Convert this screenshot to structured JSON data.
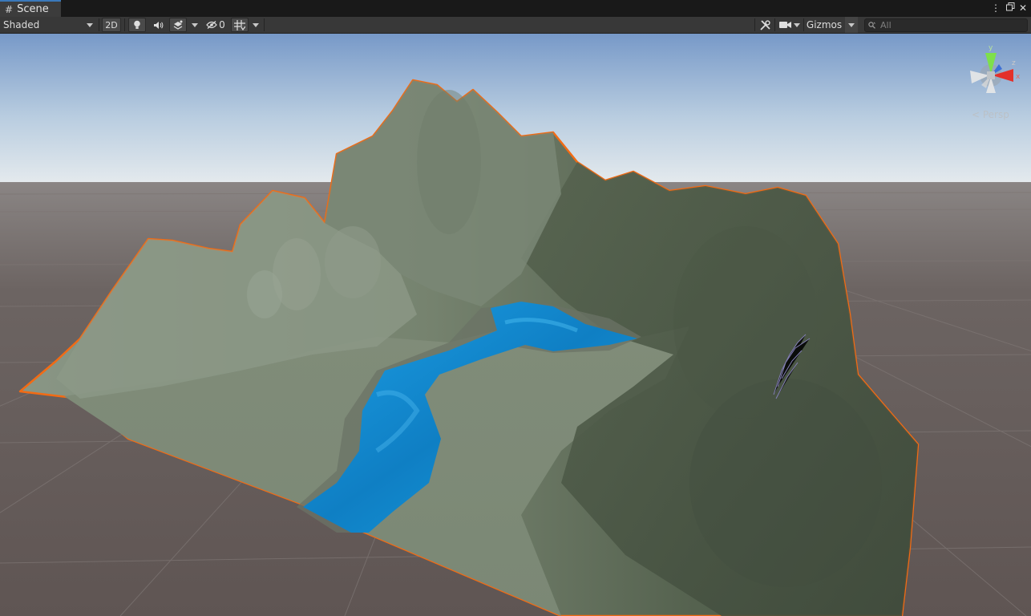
{
  "tab": {
    "title": "Scene",
    "icon": "hash-grid-icon"
  },
  "toolbar": {
    "draw_mode": "Shaded",
    "mode_2d": "2D",
    "hidden_count": "0",
    "gizmos": "Gizmos",
    "search_placeholder": "All"
  },
  "viewport": {
    "projection_label": "< Persp",
    "axis_y": "y",
    "axis_z": "z",
    "axis_x": "x"
  },
  "colors": {
    "selection_outline": "#f26b14",
    "water": "#1b8fd8",
    "terrain": "#7e8c78",
    "ground": "#6b6361",
    "sky_top": "#7a9ccb"
  }
}
